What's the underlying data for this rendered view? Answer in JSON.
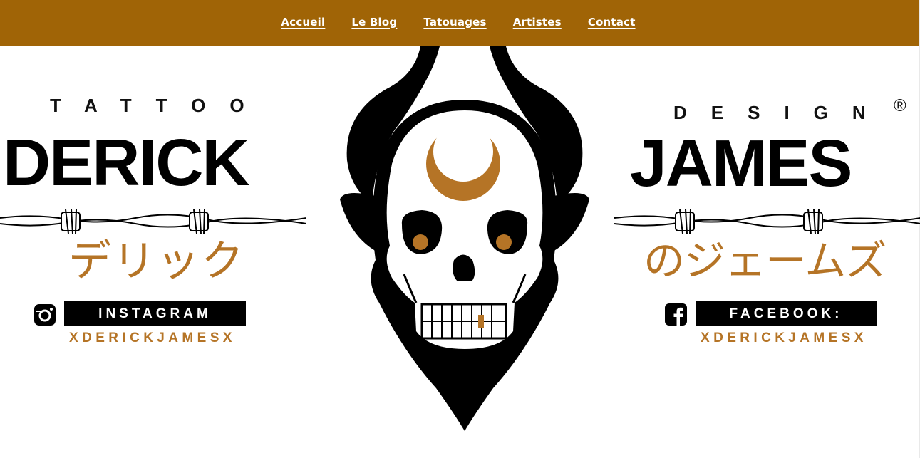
{
  "nav": {
    "items": [
      {
        "label": "Accueil"
      },
      {
        "label": "Le Blog"
      },
      {
        "label": "Tatouages"
      },
      {
        "label": "Artistes"
      },
      {
        "label": "Contact"
      }
    ]
  },
  "logo": {
    "left_top": "TATTOO",
    "left_name": "DERICK",
    "left_japanese": "デリック",
    "right_top": "DESIGN",
    "right_registered": "®",
    "right_name": "JAMES",
    "right_japanese": "のジェームズ"
  },
  "social": {
    "instagram_label": "INSTAGRAM",
    "instagram_handle": "XDERICKJAMESX",
    "facebook_label": "FACEBOOK:",
    "facebook_handle": "XDERICKJAMESX"
  },
  "icons": {
    "instagram": "instagram-icon",
    "facebook": "facebook-icon",
    "skull": "horned-skull-logo"
  },
  "colors": {
    "nav_bg": "#a06406",
    "accent": "#b57426",
    "ink": "#000000"
  }
}
